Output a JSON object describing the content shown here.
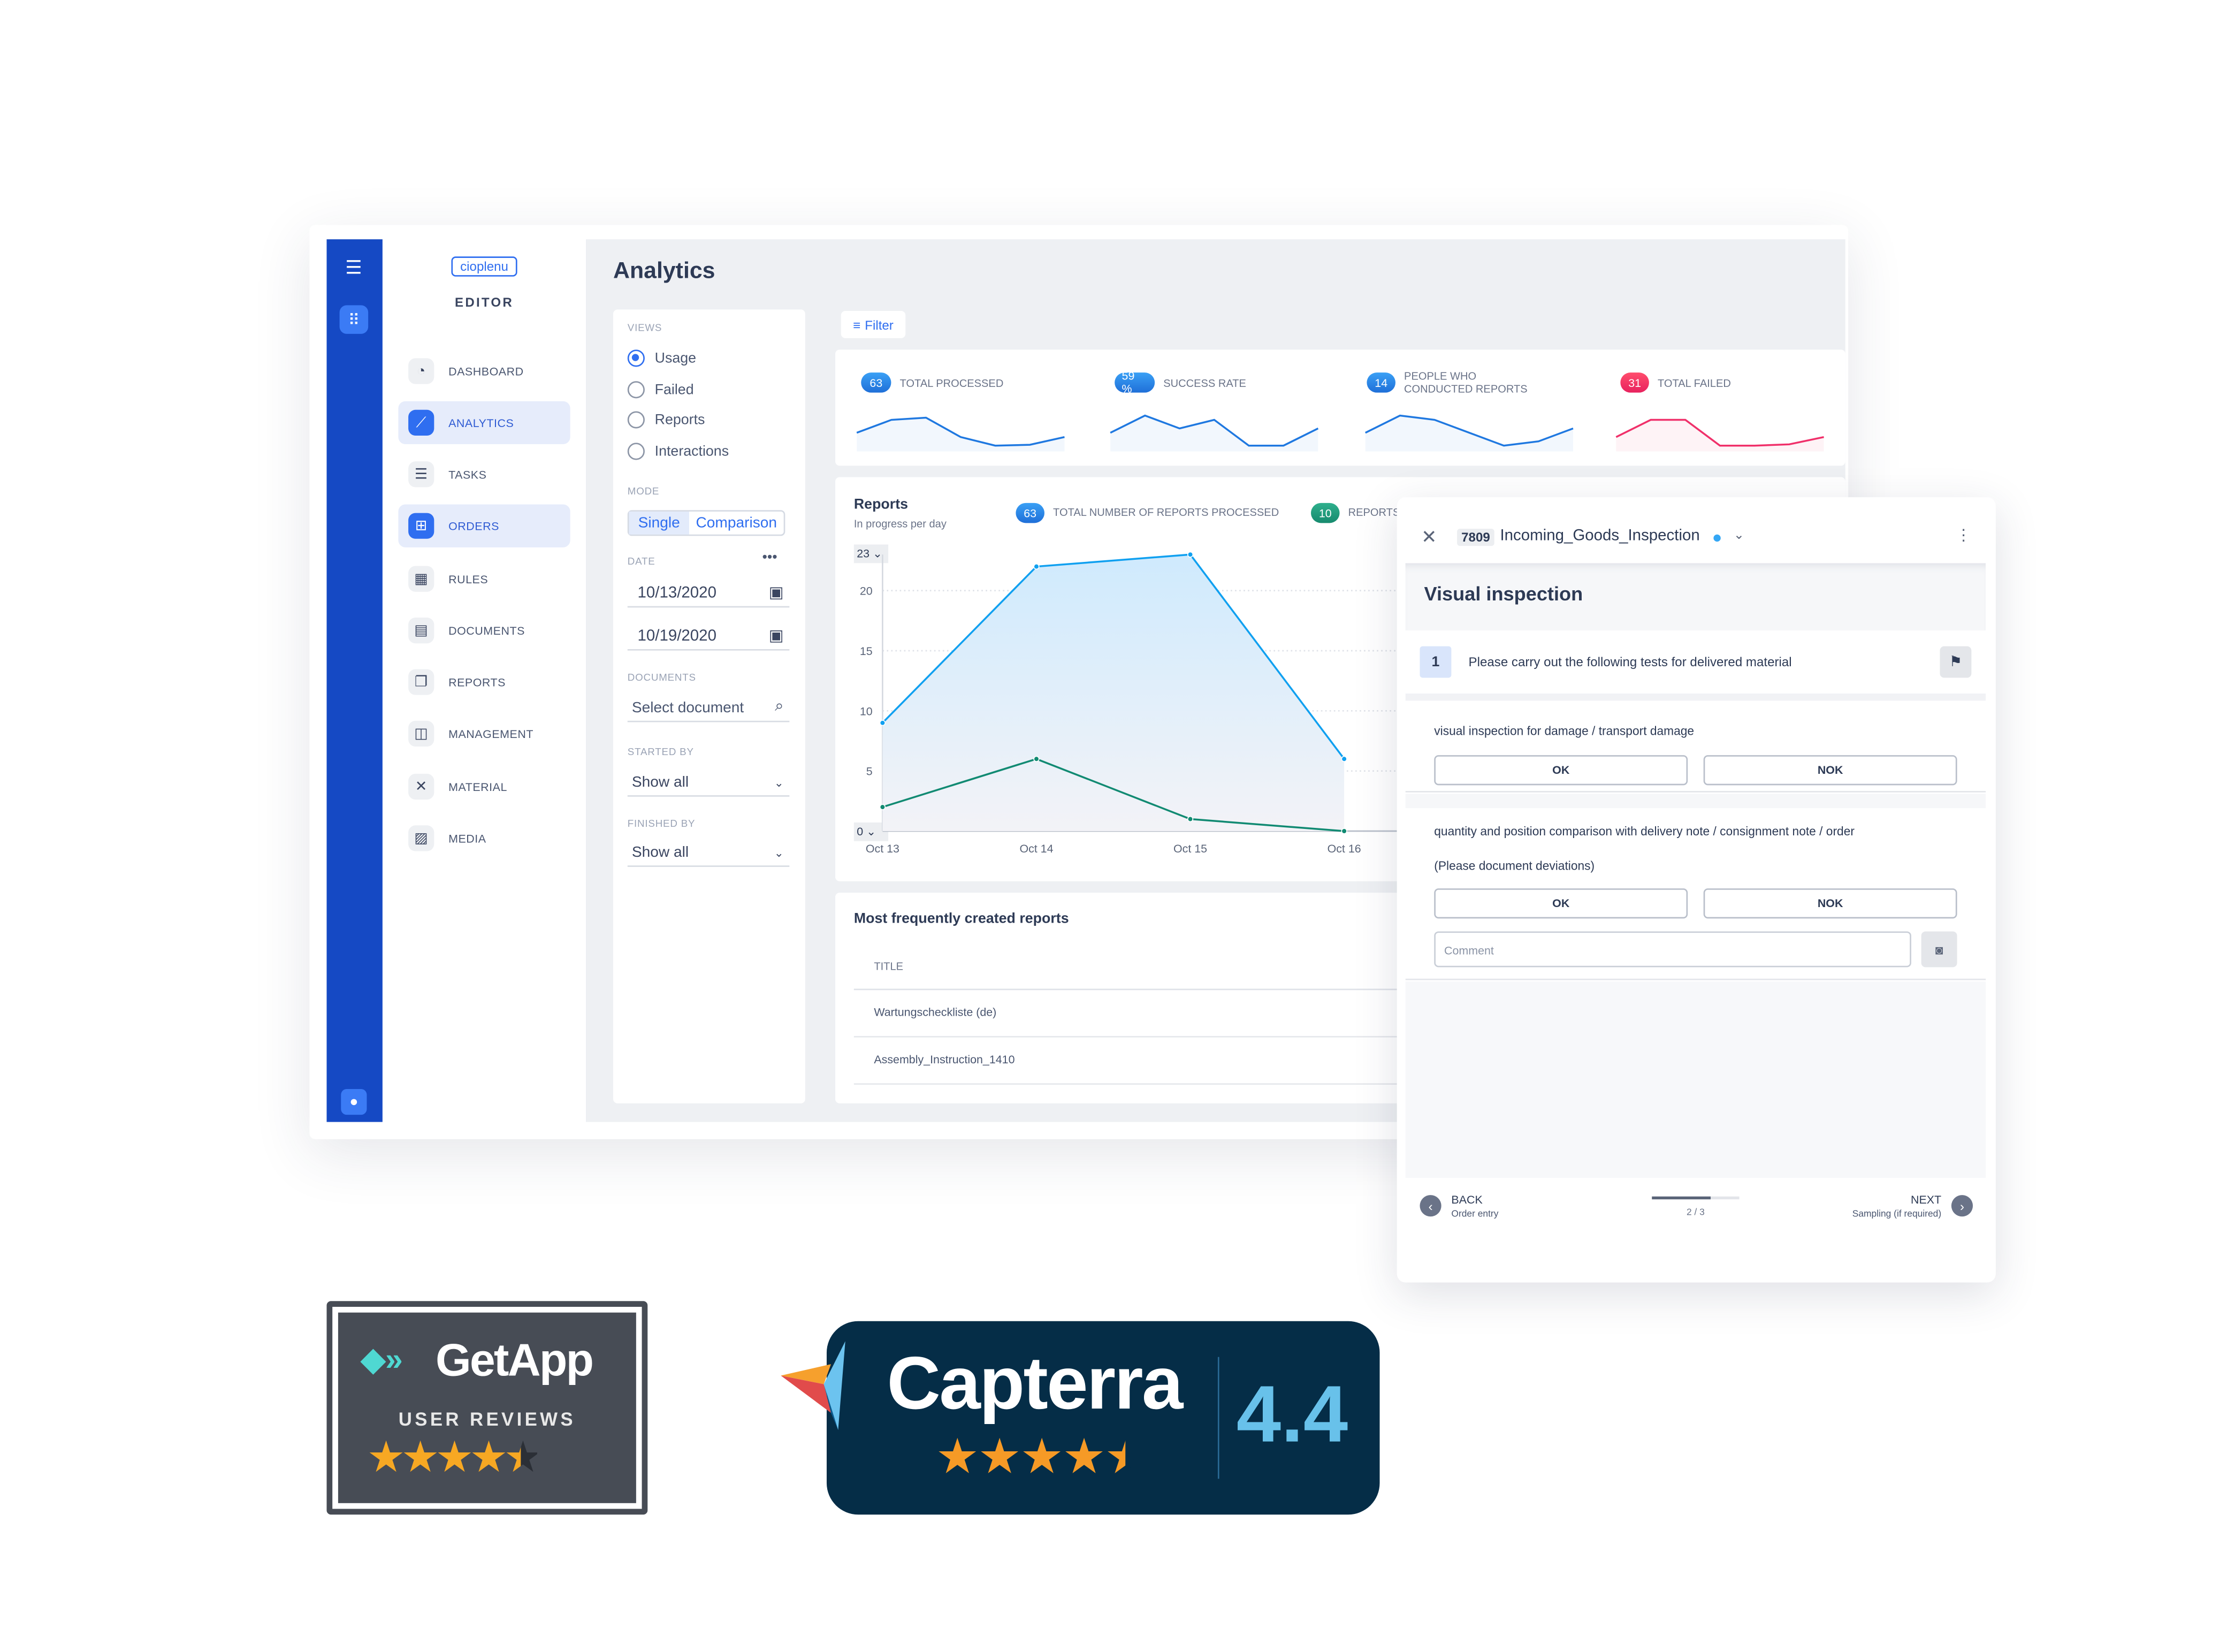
{
  "app": {
    "logo": "cioplenu",
    "section": "EDITOR"
  },
  "sidebar": {
    "items": [
      {
        "label": "DASHBOARD",
        "icon": "pie-chart-icon",
        "active": false
      },
      {
        "label": "ANALYTICS",
        "icon": "line-chart-icon",
        "active": true
      },
      {
        "label": "TASKS",
        "icon": "checklist-icon",
        "active": false
      },
      {
        "label": "ORDERS",
        "icon": "calendar-plus-icon",
        "active": true
      },
      {
        "label": "RULES",
        "icon": "calendar-grid-icon",
        "active": false
      },
      {
        "label": "DOCUMENTS",
        "icon": "document-icon",
        "active": false
      },
      {
        "label": "REPORTS",
        "icon": "reports-copy-icon",
        "active": false
      },
      {
        "label": "MANAGEMENT",
        "icon": "columns-icon",
        "active": false
      },
      {
        "label": "MATERIAL",
        "icon": "tools-icon",
        "active": false
      },
      {
        "label": "MEDIA",
        "icon": "images-icon",
        "active": false
      }
    ]
  },
  "page": {
    "title": "Analytics",
    "filter_label": "Filter"
  },
  "filters": {
    "views_label": "VIEWS",
    "views": [
      "Usage",
      "Failed",
      "Reports",
      "Interactions"
    ],
    "views_selected": "Usage",
    "mode_label": "MODE",
    "mode_options": [
      "Single",
      "Comparison"
    ],
    "mode_selected": "Single",
    "date_label": "DATE",
    "date_from": "10/13/2020",
    "date_to": "10/19/2020",
    "documents_label": "DOCUMENTS",
    "documents_placeholder": "Select document",
    "started_by_label": "STARTED BY",
    "started_by": "Show all",
    "finished_by_label": "FINISHED BY",
    "finished_by": "Show all"
  },
  "kpis": [
    {
      "value": "63",
      "label": "TOTAL PROCESSED",
      "color": "#1f78e0",
      "spark": [
        3,
        6,
        6.5,
        2,
        0,
        0.2,
        2
      ]
    },
    {
      "value": "59 %",
      "label": "SUCCESS RATE",
      "color": "#1f78e0",
      "spark": [
        3,
        7,
        4,
        6,
        0,
        0,
        4
      ]
    },
    {
      "value": "14",
      "label": "PEOPLE WHO CONDUCTED REPORTS",
      "color": "#1f78e0",
      "spark": [
        3,
        7,
        6,
        3,
        0,
        1,
        4
      ]
    },
    {
      "value": "31",
      "label": "TOTAL FAILED",
      "color": "#f0306a",
      "spark": [
        2,
        6,
        6,
        0,
        0,
        0.3,
        2
      ]
    }
  ],
  "reports_chart": {
    "title": "Reports",
    "subtitle": "In progress per day",
    "legend": [
      {
        "value": "63",
        "label": "TOTAL NUMBER OF REPORTS PROCESSED",
        "color": "#1f8ae8"
      },
      {
        "value": "10",
        "label": "REPORTS",
        "color": "#1f9a7c"
      }
    ],
    "ymax_select": "23",
    "ymin_select": "0"
  },
  "chart_data": {
    "type": "area",
    "x": [
      "Oct 13",
      "Oct 14",
      "Oct 15",
      "Oct 16"
    ],
    "yticks": [
      5,
      10,
      15,
      20
    ],
    "ylim": [
      0,
      23
    ],
    "grid": true,
    "series": [
      {
        "name": "TOTAL NUMBER OF REPORTS PROCESSED",
        "color": "#10a0f0",
        "values": [
          9,
          22,
          23,
          6
        ]
      },
      {
        "name": "REPORTS",
        "color": "#118a72",
        "values": [
          2,
          6,
          1,
          0
        ]
      }
    ]
  },
  "frequent_reports": {
    "title": "Most frequently created reports",
    "column": "TITLE",
    "rows": [
      "Wartungscheckliste (de)",
      "Assembly_Instruction_1410"
    ]
  },
  "inspection": {
    "order_id": "7809",
    "name": "Incoming_Goods_Inspection",
    "section_title": "Visual inspection",
    "step_number": "1",
    "step_text": "Please carry out the following tests for delivered material",
    "checks": [
      {
        "text": "visual inspection for damage / transport damage",
        "ok": "OK",
        "nok": "NOK"
      },
      {
        "text": "quantity and position comparison with delivery note / consignment note / order",
        "note": "(Please document deviations)",
        "ok": "OK",
        "nok": "NOK"
      }
    ],
    "comment_placeholder": "Comment",
    "back_label": "BACK",
    "back_sub": "Order entry",
    "next_label": "NEXT",
    "next_sub": "Sampling (if required)",
    "progress_text": "2 / 3",
    "progress": 0.67
  },
  "badges": {
    "getapp": {
      "brand": "GetApp",
      "sub": "USER REVIEWS",
      "stars": 4.5
    },
    "capterra": {
      "brand": "Capterra",
      "rating": "4.4",
      "stars": 4.5
    }
  }
}
